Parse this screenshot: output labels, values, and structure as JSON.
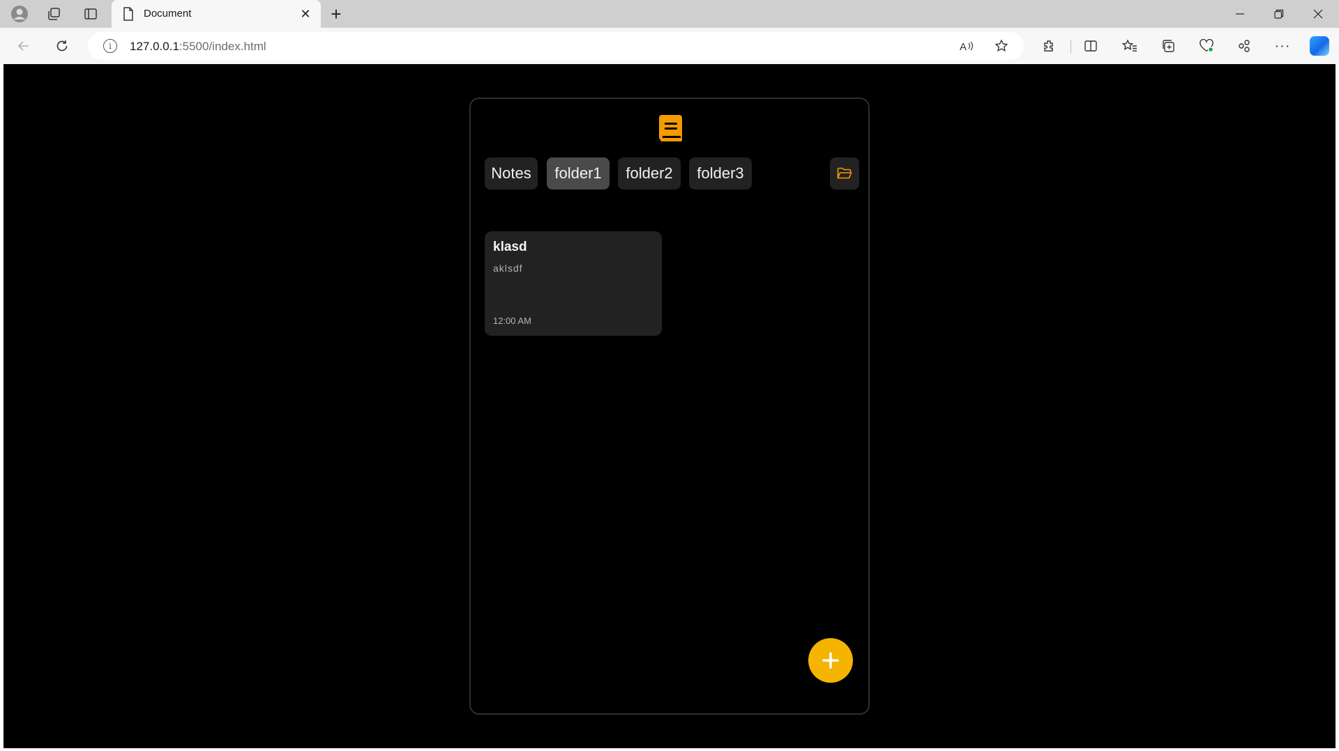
{
  "browser": {
    "tab_title": "Document",
    "new_tab_symbol": "+",
    "url_host": "127.0.0.1",
    "url_path": ":5500/index.html"
  },
  "app": {
    "folders": [
      {
        "label": "Notes",
        "active": false
      },
      {
        "label": "folder1",
        "active": true
      },
      {
        "label": "folder2",
        "active": false
      },
      {
        "label": "folder3",
        "active": false
      }
    ],
    "notes": [
      {
        "title": "klasd",
        "body": "aklsdf",
        "time": "12:00 AM"
      }
    ],
    "icons": {
      "logo": "notebook-icon",
      "folder_button": "folder-open-icon",
      "add_button": "plus-icon"
    },
    "colors": {
      "background": "#000000",
      "chip": "#222222",
      "chip_active": "#4a4a4a",
      "accent": "#f5b400",
      "logo": "#f59a00"
    }
  }
}
